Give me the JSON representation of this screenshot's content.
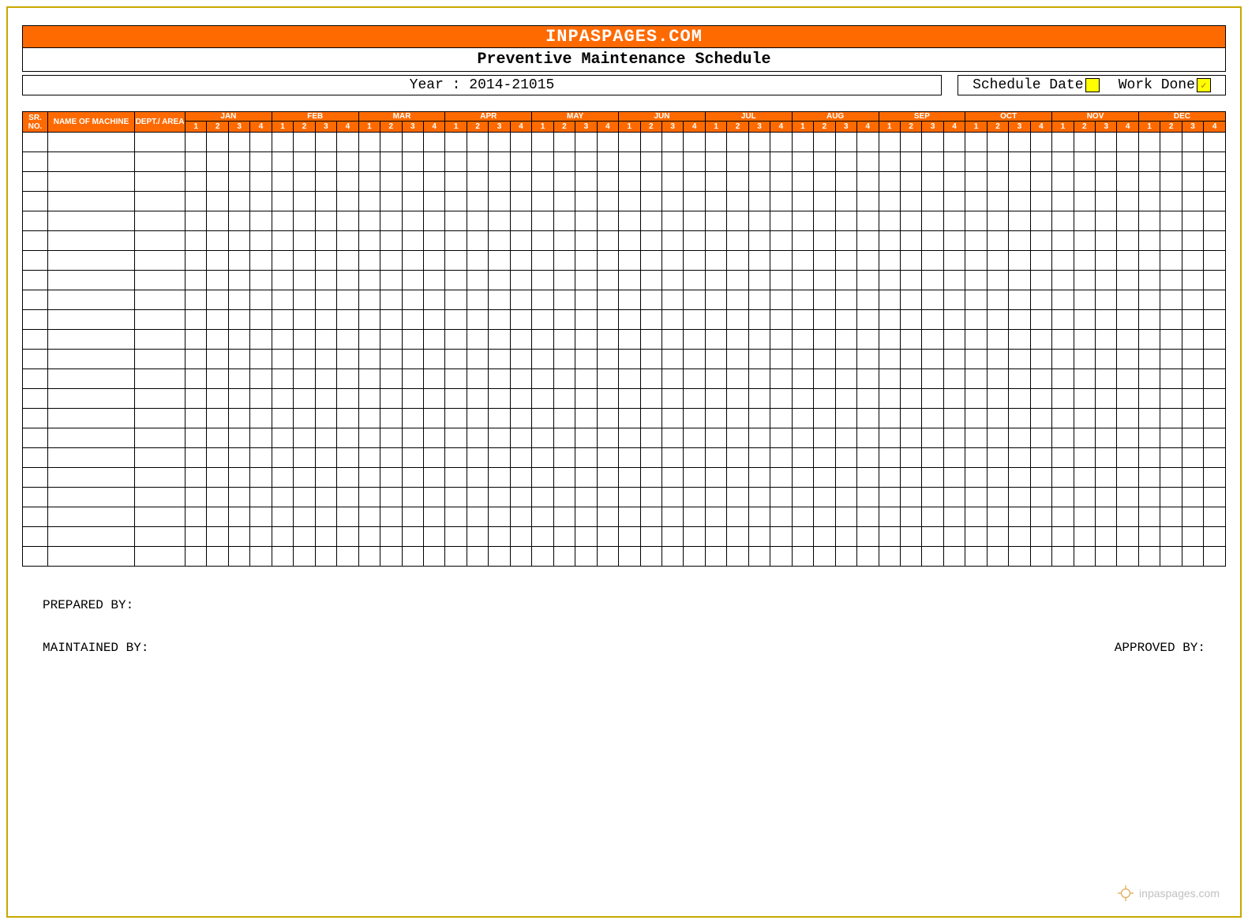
{
  "header": {
    "site": "INPASPAGES.COM",
    "title": "Preventive Maintenance Schedule",
    "year_label": "Year : 2014-21015",
    "legend_schedule": "Schedule Date",
    "legend_done": "Work Done",
    "done_mark": "✓"
  },
  "columns": {
    "sr": "SR. NO.",
    "name": "NAME OF MACHINE",
    "dept": "DEPT./ AREA"
  },
  "months": [
    "JAN",
    "FEB",
    "MAR",
    "APR",
    "MAY",
    "JUN",
    "JUL",
    "AUG",
    "SEP",
    "OCT",
    "NOV",
    "DEC"
  ],
  "weeks": [
    "1",
    "2",
    "3",
    "4"
  ],
  "row_count": 22,
  "footer": {
    "prepared": "PREPARED BY:",
    "maintained": "MAINTAINED BY:",
    "approved": "APPROVED BY:"
  },
  "watermark": "inpaspages.com"
}
